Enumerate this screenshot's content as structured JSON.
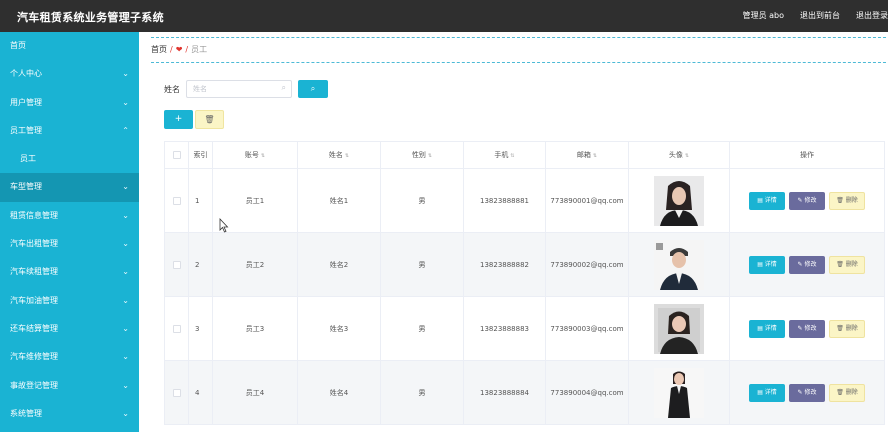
{
  "app": {
    "title": "汽车租赁系统业务管理子系统",
    "admin_label": "管理员 abo",
    "frontend_link": "退出到前台",
    "logout_link": "退出登录"
  },
  "sidebar": {
    "items": [
      {
        "label": "首页",
        "expandable": false
      },
      {
        "label": "个人中心",
        "expandable": true
      },
      {
        "label": "用户管理",
        "expandable": true
      },
      {
        "label": "员工管理",
        "expandable": true,
        "expanded": true
      },
      {
        "label": "员工",
        "sub": true
      },
      {
        "label": "车型管理",
        "expandable": true,
        "active": true
      },
      {
        "label": "租赁信息管理",
        "expandable": true
      },
      {
        "label": "汽车出租管理",
        "expandable": true
      },
      {
        "label": "汽车续租管理",
        "expandable": true
      },
      {
        "label": "汽车加油管理",
        "expandable": true
      },
      {
        "label": "还车结算管理",
        "expandable": true
      },
      {
        "label": "汽车维修管理",
        "expandable": true
      },
      {
        "label": "事故登记管理",
        "expandable": true
      },
      {
        "label": "系统管理",
        "expandable": true
      }
    ]
  },
  "breadcrumb": {
    "home": "首页",
    "separator": "/",
    "current": "员工"
  },
  "search": {
    "label": "姓名",
    "placeholder": "姓名",
    "button_icon": "search-icon"
  },
  "toolbar": {
    "add_icon": "plus-icon",
    "delete_icon": "trash-icon"
  },
  "table": {
    "headers": {
      "index": "索引",
      "account": "账号",
      "name": "姓名",
      "gender": "性别",
      "phone": "手机",
      "email": "邮箱",
      "avatar": "头像",
      "actions": "操作"
    },
    "rows": [
      {
        "index": "1",
        "account": "员工1",
        "name": "姓名1",
        "gender": "男",
        "phone": "13823888881",
        "email": "773890001@qq.com"
      },
      {
        "index": "2",
        "account": "员工2",
        "name": "姓名2",
        "gender": "男",
        "phone": "13823888882",
        "email": "773890002@qq.com"
      },
      {
        "index": "3",
        "account": "员工3",
        "name": "姓名3",
        "gender": "男",
        "phone": "13823888883",
        "email": "773890003@qq.com"
      },
      {
        "index": "4",
        "account": "员工4",
        "name": "姓名4",
        "gender": "男",
        "phone": "13823888884",
        "email": "773890004@qq.com"
      }
    ],
    "actions": {
      "detail": "详情",
      "edit": "修改",
      "delete": "删除"
    }
  },
  "colors": {
    "topbar": "#2f2f2f",
    "sidebar": "#1ab3d3",
    "sidebar_active": "#1496b2",
    "primary": "#1ab3d3",
    "edit": "#6a6b9d",
    "delete_bg": "#fbf5c6"
  }
}
